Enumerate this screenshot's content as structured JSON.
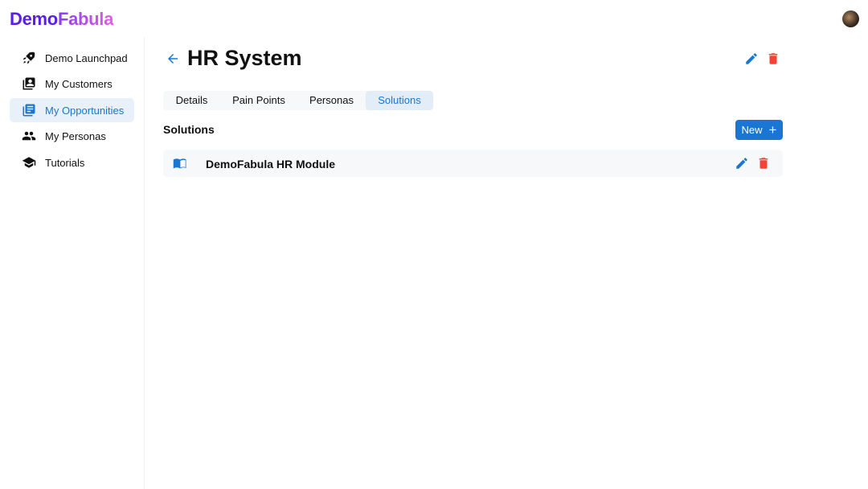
{
  "app": {
    "logo_part1": "Demo",
    "logo_part2": "Fabula"
  },
  "sidebar": {
    "items": [
      {
        "label": "Demo Launchpad",
        "icon": "rocket-icon"
      },
      {
        "label": "My Customers",
        "icon": "contacts-icon"
      },
      {
        "label": "My Opportunities",
        "icon": "library-books-icon",
        "active": true
      },
      {
        "label": "My Personas",
        "icon": "people-icon"
      },
      {
        "label": "Tutorials",
        "icon": "school-icon"
      }
    ]
  },
  "header": {
    "title": "HR System"
  },
  "tabs": [
    {
      "label": "Details"
    },
    {
      "label": "Pain Points"
    },
    {
      "label": "Personas"
    },
    {
      "label": "Solutions",
      "active": true
    }
  ],
  "section": {
    "title": "Solutions",
    "new_label": "New"
  },
  "solutions": [
    {
      "name": "DemoFabula HR Module",
      "icon": "menu-book-icon"
    }
  ],
  "colors": {
    "accent": "#1976d2",
    "danger": "#f44336",
    "active_bg": "#e8f0fa"
  }
}
